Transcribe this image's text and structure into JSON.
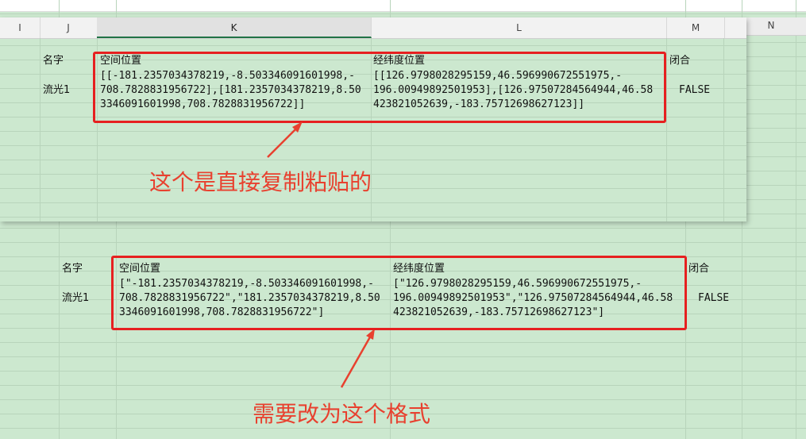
{
  "top_panel": {
    "column_headers": [
      "I",
      "J",
      "K",
      "L",
      "M"
    ],
    "header_name": "名字",
    "header_space": "空间位置",
    "header_latlon": "经纬度位置",
    "header_closed": "闭合",
    "row_name": "流光1",
    "space_lines": [
      "[[-181.2357034378219,-8.503346091601998,-",
      "708.7828831956722],[181.2357034378219,8.50",
      "3346091601998,708.7828831956722]]"
    ],
    "latlon_lines": [
      "[[126.9798028295159,46.596990672551975,-",
      "196.00949892501953],[126.97507284564944,46.58",
      "423821052639,-183.75712698627123]]"
    ],
    "closed_value": "FALSE",
    "annotation": "这个是直接复制粘贴的"
  },
  "background_sheet": {
    "column_header_n": "N"
  },
  "bottom_section": {
    "header_name": "名字",
    "header_space": "空间位置",
    "header_latlon": "经纬度位置",
    "header_closed": "闭合",
    "row_name": "流光1",
    "space_lines": [
      "[\"-181.2357034378219,-8.503346091601998,-",
      "708.7828831956722\",\"181.2357034378219,8.50",
      "3346091601998,708.7828831956722\"]"
    ],
    "latlon_lines": [
      "[\"126.9798028295159,46.596990672551975,-",
      "196.00949892501953\",\"126.97507284564944,46.58",
      "423821052639,-183.75712698627123\"]"
    ],
    "closed_value": "FALSE",
    "annotation": "需要改为这个格式"
  },
  "colors": {
    "sheet_green": "#cce8cf",
    "highlight_red": "#e62020",
    "annotation_red": "#e8412f"
  }
}
